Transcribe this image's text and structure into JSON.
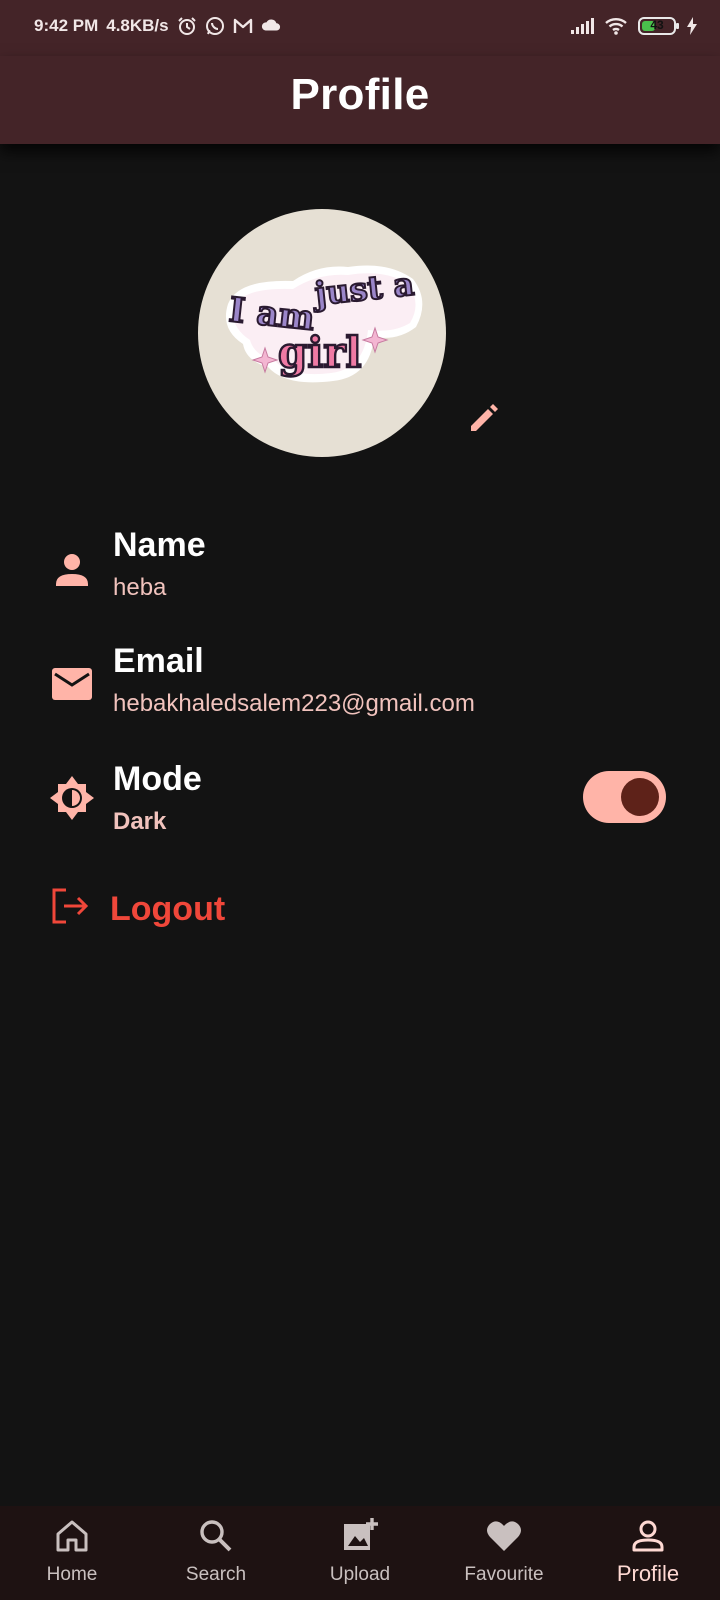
{
  "status_bar": {
    "time": "9:42 PM",
    "speed": "4.8KB/s",
    "battery": "43",
    "battery_level": 0.43,
    "icons": [
      "alarm-icon",
      "whatsapp-icon",
      "gmail-icon",
      "cloud-icon",
      "signal-icon",
      "wifi-icon",
      "battery-icon",
      "charging-icon"
    ]
  },
  "app_bar": {
    "title": "Profile"
  },
  "avatar": {
    "image_text": "I am just a girl"
  },
  "profile": {
    "name_label": "Name",
    "name_value": "heba",
    "email_label": "Email",
    "email_value": "hebakhaledsalem223@gmail.com",
    "mode_label": "Mode",
    "mode_value": "Dark",
    "mode_enabled": true,
    "logout_label": "Logout"
  },
  "bottom_nav": {
    "items": [
      {
        "label": "Home",
        "icon": "home-icon"
      },
      {
        "label": "Search",
        "icon": "search-icon"
      },
      {
        "label": "Upload",
        "icon": "add-photo-icon"
      },
      {
        "label": "Favourite",
        "icon": "heart-icon"
      },
      {
        "label": "Profile",
        "icon": "person-icon",
        "active": true
      }
    ]
  },
  "colors": {
    "app_bar": "#442428",
    "background": "#131313",
    "accent": "#ffb4a8",
    "logout": "#f0473a",
    "nav_bar": "#1e1212"
  }
}
